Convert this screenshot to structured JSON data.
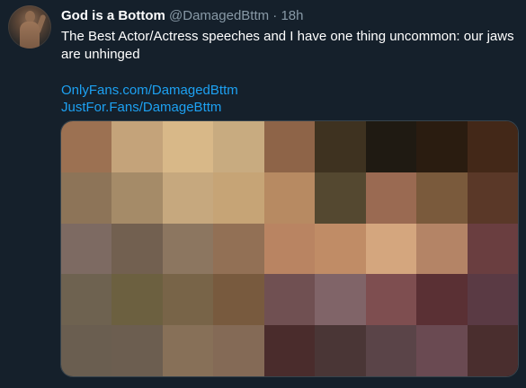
{
  "tweet": {
    "display_name": "God is a Bottom",
    "handle": "@DamagedBttm",
    "separator": "·",
    "timestamp": "18h",
    "text": "The Best Actor/Actress speeches and I have one thing uncommon: our jaws are unhinged",
    "links": [
      "OnlyFans.com/DamagedBttm",
      "JustFor.Fans/DamageBttm"
    ]
  },
  "media": {
    "description_icon": "pixelated-image",
    "mosaic_colors": [
      [
        "#9c7152",
        "#c4a37a",
        "#d8b888",
        "#c8ab80",
        "#8e6448",
        "#3e3220",
        "#1f1a12",
        "#2a1c10",
        "#432818"
      ],
      [
        "#8d7458",
        "#a58b68",
        "#c6a87e",
        "#c6a476",
        "#b78a62",
        "#544830",
        "#9a6a52",
        "#7a5a3c",
        "#5a3828"
      ],
      [
        "#7d6a62",
        "#726050",
        "#8c7660",
        "#927055",
        "#b98462",
        "#c08c66",
        "#d4a67e",
        "#b48466",
        "#6a3e40"
      ],
      [
        "#6e6250",
        "#6c6040",
        "#786448",
        "#785a3e",
        "#705052",
        "#806468",
        "#7e4e50",
        "#5a3034",
        "#5a3a44"
      ],
      [
        "#6a5e50",
        "#6c5e50",
        "#877058",
        "#846a56",
        "#4a2c2c",
        "#4a3636",
        "#5a4448",
        "#6a4a52",
        "#4a2e2e"
      ]
    ]
  }
}
